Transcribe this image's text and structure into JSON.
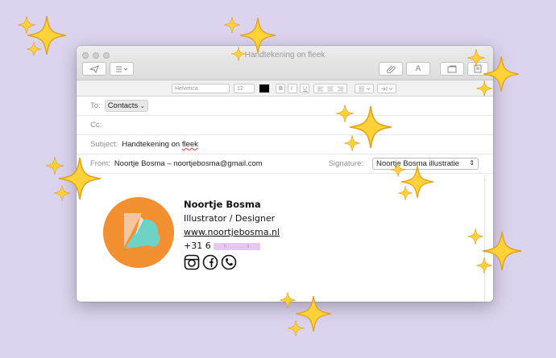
{
  "window": {
    "title": "Handtekening on fleek"
  },
  "toolbar": {
    "send_icon": "paper-plane-icon",
    "header_fields_icon": "list-icon",
    "attach_icon": "paperclip-icon",
    "font_label": "A",
    "photo_icon": "photo-browser-icon",
    "stationery_icon": "stationery-icon"
  },
  "format": {
    "font": "Helvetica",
    "size": "12",
    "text_color": "#000000",
    "bold": "B",
    "italic": "I",
    "underline": "U"
  },
  "to": {
    "label": "To:",
    "value": "Contacts"
  },
  "cc": {
    "label": "Cc:"
  },
  "subject": {
    "label": "Subject:",
    "value_prefix": "Handtekening on ",
    "value_misspelled": "fleek"
  },
  "from": {
    "label": "From:",
    "value": "Noortje Bosma – noortjebosma@gmail.com",
    "signature_label": "Signature:",
    "signature_value": "Noortje Bosma illustratie"
  },
  "signature": {
    "name": "Noortje Bosma",
    "role": "Illustrator / Designer",
    "website": "www.noortjebosma.nl",
    "phone_prefix": "+31 6",
    "phone_hidden": "h ...... d",
    "social": [
      "instagram-icon",
      "facebook-icon",
      "phone-icon"
    ],
    "logo_colors": {
      "circle": "#f39132",
      "light": "#f6c6a0",
      "teal": "#6dd3c6"
    }
  },
  "colors": {
    "background": "#dcd3ee",
    "sparkle": "#ffd23a"
  }
}
